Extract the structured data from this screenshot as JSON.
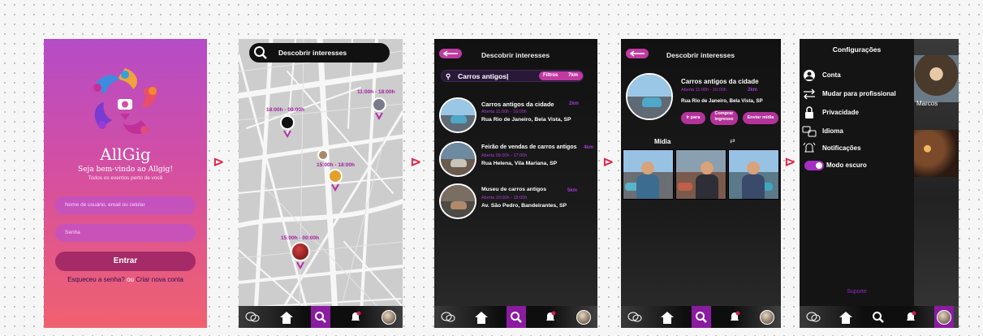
{
  "colors": {
    "accent": "#8a1ca0",
    "pink": "#b3339a",
    "arrow": "#e0254b",
    "dark_bg": "#111111"
  },
  "login": {
    "app_name": "AllGig",
    "welcome": "Seja bem-vindo ao Allgig!",
    "subtitle": "Todos os eventos perto de você",
    "username_placeholder": "Nome de usuário, email ou celular",
    "password_placeholder": "Senha",
    "enter_label": "Entrar",
    "forgot_label": "Esqueceu a senha?",
    "or_label": "ou",
    "create_label": "Criar nova conta"
  },
  "map_screen": {
    "search_title": "Descobrir interesses",
    "pins": [
      {
        "label": "11:00h - 18:00h"
      },
      {
        "label": "18:00h - 00:00h"
      },
      {
        "label": "15:00h - 18:00h"
      },
      {
        "label": "15:00h - 00:00h"
      }
    ]
  },
  "nav_icons": [
    "chat-icon",
    "home-icon",
    "search-icon",
    "bell-icon",
    "profile-avatar"
  ],
  "search_screen": {
    "title": "Descobrir interesses",
    "query": "Carros antigos|",
    "filters_label": "Filtros",
    "radius": "7km",
    "results": [
      {
        "name": "Carros antigos da cidade",
        "distance": "2km",
        "open": "Aberta 11:00h - 16:00h",
        "address": "Rua Rio de Janeiro, Bela Vista, SP"
      },
      {
        "name": "Feirão de vendas de carros antigos",
        "distance": "4km",
        "open": "Aberta 09:00h - 17:00h",
        "address": "Rua Helena, Vila Mariana, SP"
      },
      {
        "name": "Museu de carros antigos",
        "distance": "5km",
        "open": "Aberta 10:00h - 18:00h",
        "address": "Av. São Pedro, Bandeirantes, SP"
      }
    ]
  },
  "detail_screen": {
    "title": "Descobrir interesses",
    "name": "Carros antigos da cidade",
    "open": "Aberta 11:00h - 16:00h",
    "distance": "2km",
    "address": "Rua Rio de Janeiro, Bela Vista, SP",
    "go_label": "Ir para",
    "buy_label_1": "Comprar",
    "buy_label_2": "ingresso",
    "send_label": "Enviar mídia",
    "media_label": "Mídia",
    "swap_icon": "⇄"
  },
  "settings_screen": {
    "title": "Configurações",
    "items": [
      {
        "icon": "account-icon",
        "label": "Conta"
      },
      {
        "icon": "switch-icon",
        "label": "Mudar para profissional"
      },
      {
        "icon": "lock-icon",
        "label": "Privacidade"
      },
      {
        "icon": "language-icon",
        "label": "Idioma"
      },
      {
        "icon": "bell-icon",
        "label": "Notificações"
      }
    ],
    "dark_mode_label": "Modo escuro",
    "dark_mode_on": true,
    "support_label": "Suporte",
    "profile_name": "Marcos"
  },
  "arrows": [
    "⊳",
    "⊳",
    "⊳",
    "⊳"
  ]
}
